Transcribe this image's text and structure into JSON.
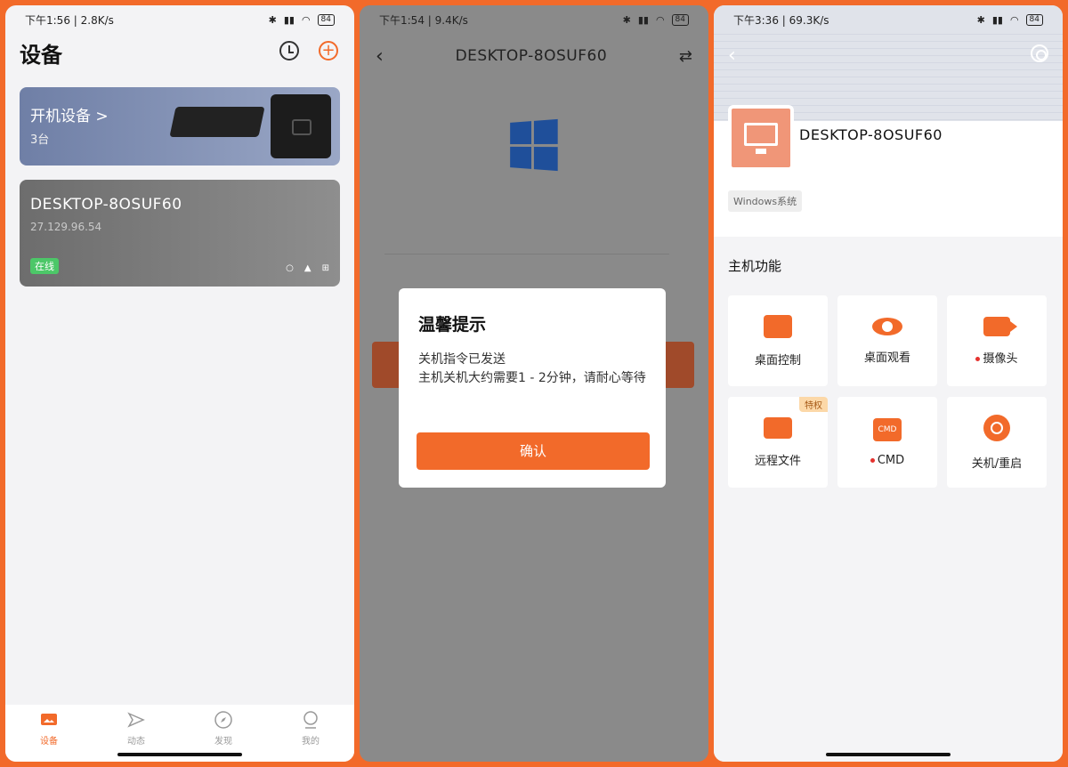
{
  "colors": {
    "accent": "#f26a2a",
    "online": "#4cc768"
  },
  "phone1": {
    "status": {
      "time": "下午1:56 | 2.8K/s",
      "battery": "84"
    },
    "title": "设备",
    "banner": {
      "title": "开机设备 >",
      "subtitle": "3台"
    },
    "device": {
      "name": "DESKTOP-8OSUF60",
      "ip": "27.129.96.54",
      "status": "在线"
    },
    "tabs": [
      {
        "label": "设备",
        "icon": "device-icon"
      },
      {
        "label": "动态",
        "icon": "send-icon"
      },
      {
        "label": "发现",
        "icon": "compass-icon"
      },
      {
        "label": "我的",
        "icon": "profile-icon"
      }
    ]
  },
  "phone2": {
    "status": {
      "time": "下午1:54 | 9.4K/s",
      "battery": "84"
    },
    "title": "DESKTOP-8OSUF60",
    "dialog": {
      "title": "温馨提示",
      "line1": "关机指令已发送",
      "line2": "主机关机大约需要1 - 2分钟，请耐心等待",
      "confirm": "确认"
    }
  },
  "phone3": {
    "status": {
      "time": "下午3:36 | 69.3K/s",
      "battery": "84"
    },
    "device_name": "DESKTOP-8OSUF60",
    "system_tag": "Windows系统",
    "section_title": "主机功能",
    "functions": [
      {
        "label": "桌面控制",
        "icon": "desktop-control-icon",
        "dot": false,
        "badge": ""
      },
      {
        "label": "桌面观看",
        "icon": "eye-icon",
        "dot": false,
        "badge": ""
      },
      {
        "label": "摄像头",
        "icon": "camera-icon",
        "dot": true,
        "badge": ""
      },
      {
        "label": "远程文件",
        "icon": "folder-icon",
        "dot": false,
        "badge": "特权"
      },
      {
        "label": "CMD",
        "icon": "cmd-icon",
        "dot": true,
        "badge": ""
      },
      {
        "label": "关机/重启",
        "icon": "power-icon",
        "dot": false,
        "badge": ""
      }
    ]
  }
}
